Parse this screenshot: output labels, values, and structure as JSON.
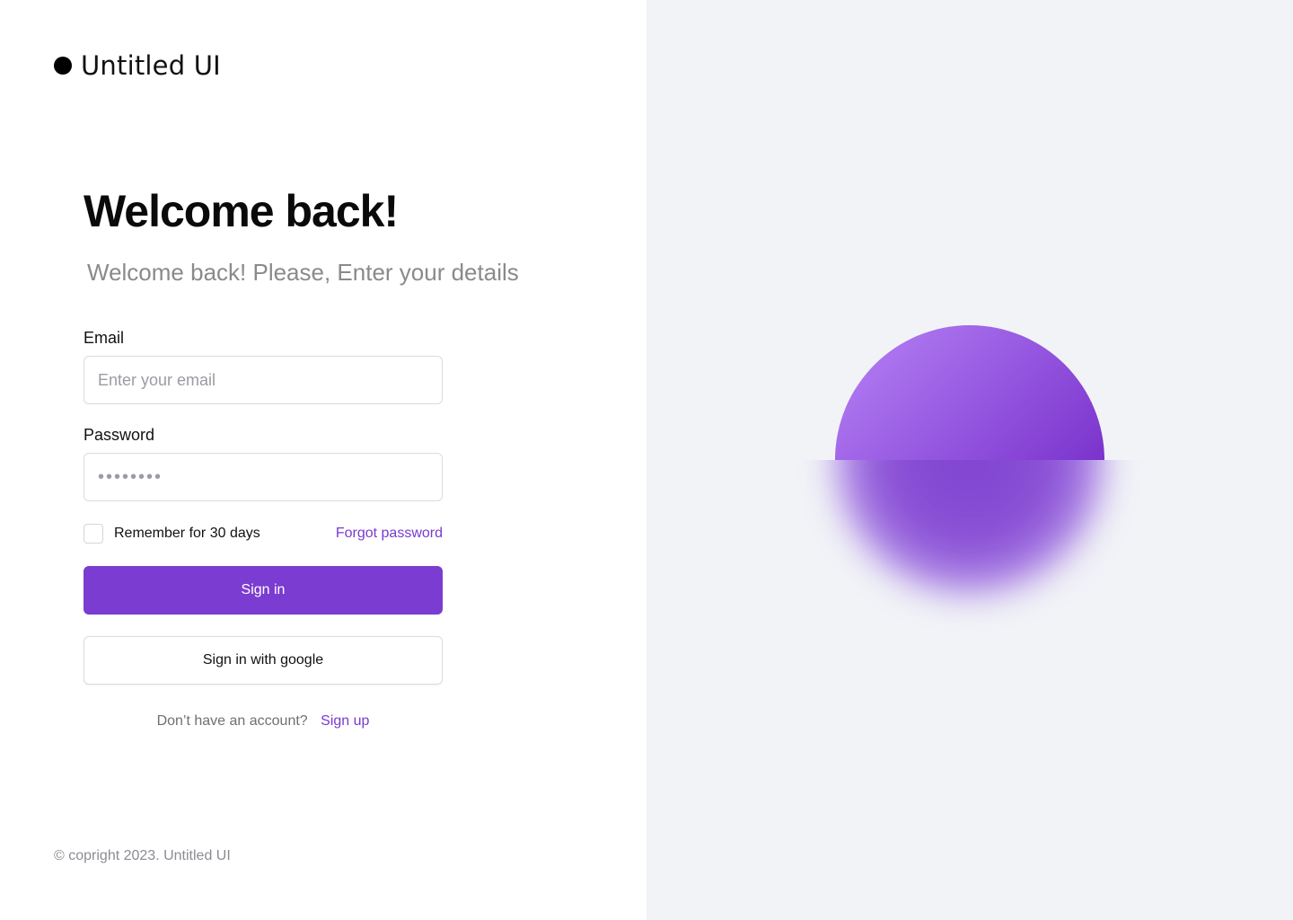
{
  "brand": {
    "name": "Untitled UI"
  },
  "heading": "Welcome back!",
  "subheading": "Welcome back! Please, Enter your details",
  "form": {
    "email_label": "Email",
    "email_placeholder": "Enter your email",
    "password_label": "Password",
    "password_placeholder": "••••••••",
    "remember_label": "Remember for 30 days",
    "forgot_label": "Forgot password",
    "signin_label": "Sign in",
    "google_label": "Sign in with google"
  },
  "signup": {
    "prompt": "Don’t have an account?",
    "link": "Sign up"
  },
  "footer": {
    "copyright": "© copright 2023. Untitled UI"
  },
  "colors": {
    "accent": "#7b3cd1",
    "link": "#7a3ad0",
    "right_panel_bg": "#f2f3f7"
  }
}
